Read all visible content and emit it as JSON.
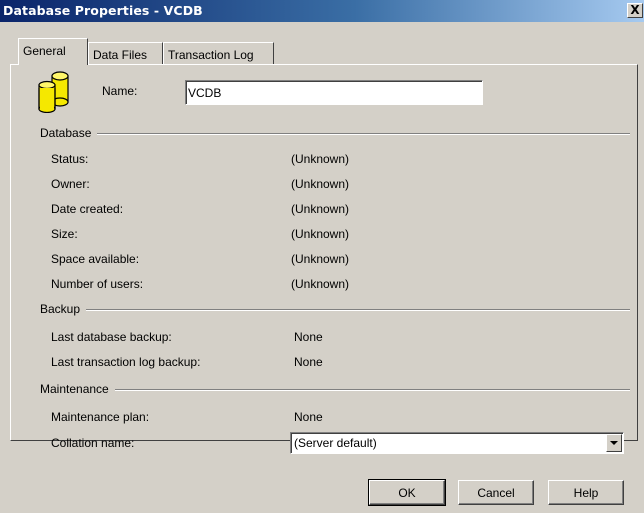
{
  "window": {
    "title": "Database Properties - VCDB",
    "close_label": "X"
  },
  "tabs": [
    {
      "label": "General",
      "active": true
    },
    {
      "label": "Data Files",
      "active": false
    },
    {
      "label": "Transaction Log",
      "active": false
    }
  ],
  "general": {
    "icon": "database-icon",
    "name_label": "Name:",
    "name_value": "VCDB"
  },
  "database": {
    "section_title": "Database",
    "rows": [
      {
        "label": "Status:",
        "value": "(Unknown)"
      },
      {
        "label": "Owner:",
        "value": "(Unknown)"
      },
      {
        "label": "Date created:",
        "value": "(Unknown)"
      },
      {
        "label": "Size:",
        "value": "(Unknown)"
      },
      {
        "label": "Space available:",
        "value": "(Unknown)"
      },
      {
        "label": "Number of users:",
        "value": "(Unknown)"
      }
    ]
  },
  "backup": {
    "section_title": "Backup",
    "rows": [
      {
        "label": "Last database backup:",
        "value": "None"
      },
      {
        "label": "Last transaction log backup:",
        "value": "None"
      }
    ]
  },
  "maintenance": {
    "section_title": "Maintenance",
    "plan_label": "Maintenance plan:",
    "plan_value": "None",
    "collation_label": "Collation name:",
    "collation_value": "(Server default)"
  },
  "buttons": {
    "ok": "OK",
    "cancel": "Cancel",
    "help": "Help"
  },
  "colors": {
    "titlebar_start": "#0a246a",
    "titlebar_end": "#a6caf0",
    "face": "#d4d0c8",
    "db_icon": "#f5e800"
  }
}
